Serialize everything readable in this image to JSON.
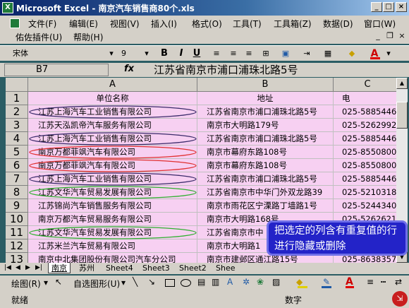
{
  "window": {
    "title": "Microsoft Excel - 南京汽车销售商80个.xls",
    "app_icon": "excel-icon"
  },
  "menu": {
    "row1": [
      "文件(F)",
      "编辑(E)",
      "视图(V)",
      "插入(I)",
      "格式(O)",
      "工具(T)",
      "工具箱(Z)",
      "数据(D)",
      "窗口(W)"
    ],
    "row2": [
      "佑佐插件(U)",
      "帮助(H)"
    ]
  },
  "toolbar": {
    "font_name": "宋体",
    "font_size": "9",
    "bold": "B",
    "italic": "I",
    "underline": "U"
  },
  "formula_bar": {
    "cell_ref": "B7",
    "fx": "fx",
    "value": "江苏省南京市浦口浦珠北路5号"
  },
  "columns": [
    "A",
    "B",
    "C"
  ],
  "header_row": {
    "num": "1",
    "a": "单位名称",
    "b": "地址",
    "c": "电"
  },
  "rows": [
    {
      "num": "2",
      "a": "江苏上海汽车工业销售有限公司",
      "b": "江苏省南京市浦口浦珠北路5号",
      "c": "025-58854460"
    },
    {
      "num": "3",
      "a": "江苏天泓凯帝汽车服务有限公司",
      "b": "南京市大明路179号",
      "c": "025-52629922"
    },
    {
      "num": "4",
      "a": "江苏上海汽车工业销售有限公司",
      "b": "江苏省南京市浦口浦珠北路5号",
      "c": "025-58854460"
    },
    {
      "num": "5",
      "a": "南京万都菲飒汽车有限公司",
      "b": "南京市幕府东路108号",
      "c": "025-85508000"
    },
    {
      "num": "6",
      "a": "南京万都菲飒汽车有限公司",
      "b": "南京市幕府东路108号",
      "c": "025-85508000"
    },
    {
      "num": "7",
      "a": "江苏上海汽车工业销售有限公司",
      "b": "江苏省南京市浦口浦珠北路5号",
      "c": "025-58854460"
    },
    {
      "num": "8",
      "a": "江苏文华汽车贸易发展有限公司",
      "b": "江苏省南京市中华门外双龙路39",
      "c": "025-52103188"
    },
    {
      "num": "9",
      "a": "江苏锦尚汽车销售服务有限公司",
      "b": "南京市雨花区宁溧路丁墙路1号",
      "c": "025-52443400"
    },
    {
      "num": "10",
      "a": "南京万都汽车贸易服务有限公司",
      "b": "南京市大明路168号",
      "c": "025-52626219"
    },
    {
      "num": "11",
      "a": "江苏文华汽车贸易发展有限公司",
      "b": "江苏省南京市中",
      "c": ""
    },
    {
      "num": "12",
      "a": "江苏米兰汽车贸易有限公司",
      "b": "南京市大明路1",
      "c": ""
    },
    {
      "num": "13",
      "a": "南京中北集团股份有限公司汽车分公司",
      "b": "南京市建邺区通江路15号",
      "c": "025-86383577"
    }
  ],
  "sheet_tabs": [
    "南京",
    "苏州",
    "Sheet4",
    "Sheet3",
    "Sheet2",
    "Shee"
  ],
  "draw_bar": {
    "draw_label": "绘图(R)",
    "autoshape_label": "自选图形(U)"
  },
  "status": {
    "left": "就绪",
    "mode": "数字"
  },
  "callout": {
    "text": "把选定的列含有重复值的行进行隐藏或删除"
  },
  "colors": {
    "row_fill": "#f7d0f2",
    "accent": "#0a246a",
    "callout_bg": "#2323c8",
    "oval_dark": "#3a2a6a",
    "oval_red": "#e03030",
    "oval_green": "#30b030"
  },
  "highlight_groups": [
    {
      "rows": [
        "2",
        "4",
        "7"
      ],
      "color": "dark"
    },
    {
      "rows": [
        "5",
        "6"
      ],
      "color": "red"
    },
    {
      "rows": [
        "8",
        "11"
      ],
      "color": "green"
    }
  ]
}
